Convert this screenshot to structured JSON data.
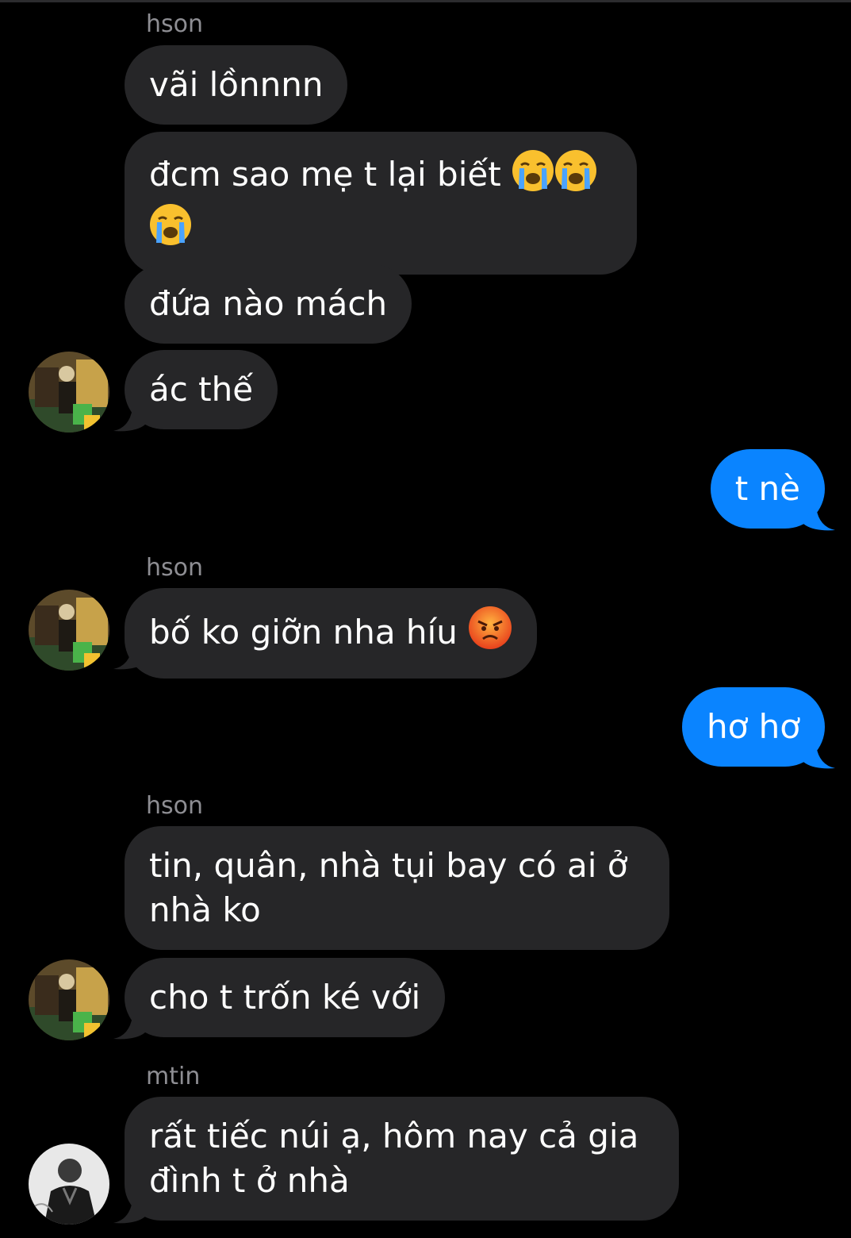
{
  "colors": {
    "background": "#000000",
    "incoming_bubble": "#262628",
    "outgoing_bubble": "#0a84ff",
    "sender_name": "#8e8e93",
    "text": "#ffffff"
  },
  "conversation": {
    "messages": [
      {
        "sender": "hson",
        "text": "vãi lồnnnn"
      },
      {
        "text": "đcm sao mẹ t lại biết",
        "trailing_emoji": [
          "loudly-crying-face",
          "loudly-crying-face",
          "loudly-crying-face"
        ]
      },
      {
        "text": "đứa nào mách"
      },
      {
        "text": "ác thế",
        "avatar": "hson-avatar"
      },
      {
        "outgoing": true,
        "text": "t nè"
      },
      {
        "sender": "hson",
        "text": "bố ko giỡn nha híu",
        "trailing_emoji": [
          "pouting-face"
        ],
        "avatar": "hson-avatar"
      },
      {
        "outgoing": true,
        "text": "hơ hơ"
      },
      {
        "sender": "hson",
        "text_line1": "tin, quân, nhà tụi bay có ai ở",
        "text_line2": "nhà ko"
      },
      {
        "text": "cho t trốn ké với",
        "avatar": "hson-avatar"
      },
      {
        "sender": "mtin",
        "text_line1": "rất tiếc núi ạ, hôm nay cả gia",
        "text_line2": "đình t ở nhà",
        "avatar": "mtin-avatar"
      }
    ]
  }
}
